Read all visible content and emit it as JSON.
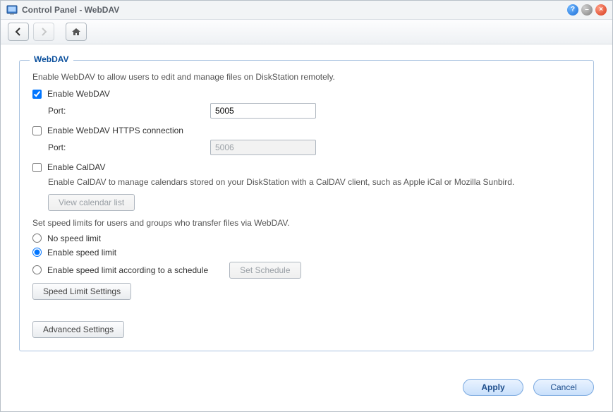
{
  "titlebar": {
    "title": "Control Panel - WebDAV"
  },
  "fieldset": {
    "legend": "WebDAV",
    "intro": "Enable WebDAV to allow users to edit and manage files on DiskStation remotely.",
    "enable_webdav": {
      "label": "Enable WebDAV",
      "checked": true,
      "port_label": "Port:",
      "port_value": "5005"
    },
    "enable_https": {
      "label": "Enable WebDAV HTTPS connection",
      "checked": false,
      "port_label": "Port:",
      "port_value": "5006"
    },
    "enable_caldav": {
      "label": "Enable CalDAV",
      "checked": false,
      "desc": "Enable CalDAV to manage calendars stored on your DiskStation with a CalDAV client, such as Apple iCal or Mozilla Sunbird.",
      "view_list_btn": "View calendar list"
    },
    "speed": {
      "intro": "Set speed limits for users and groups who transfer files via WebDAV.",
      "options": {
        "none": "No speed limit",
        "enable": "Enable speed limit",
        "schedule": "Enable speed limit according to a schedule"
      },
      "selected": "enable",
      "set_schedule_btn": "Set Schedule",
      "settings_btn": "Speed Limit Settings"
    },
    "advanced_btn": "Advanced Settings"
  },
  "footer": {
    "apply": "Apply",
    "cancel": "Cancel"
  }
}
